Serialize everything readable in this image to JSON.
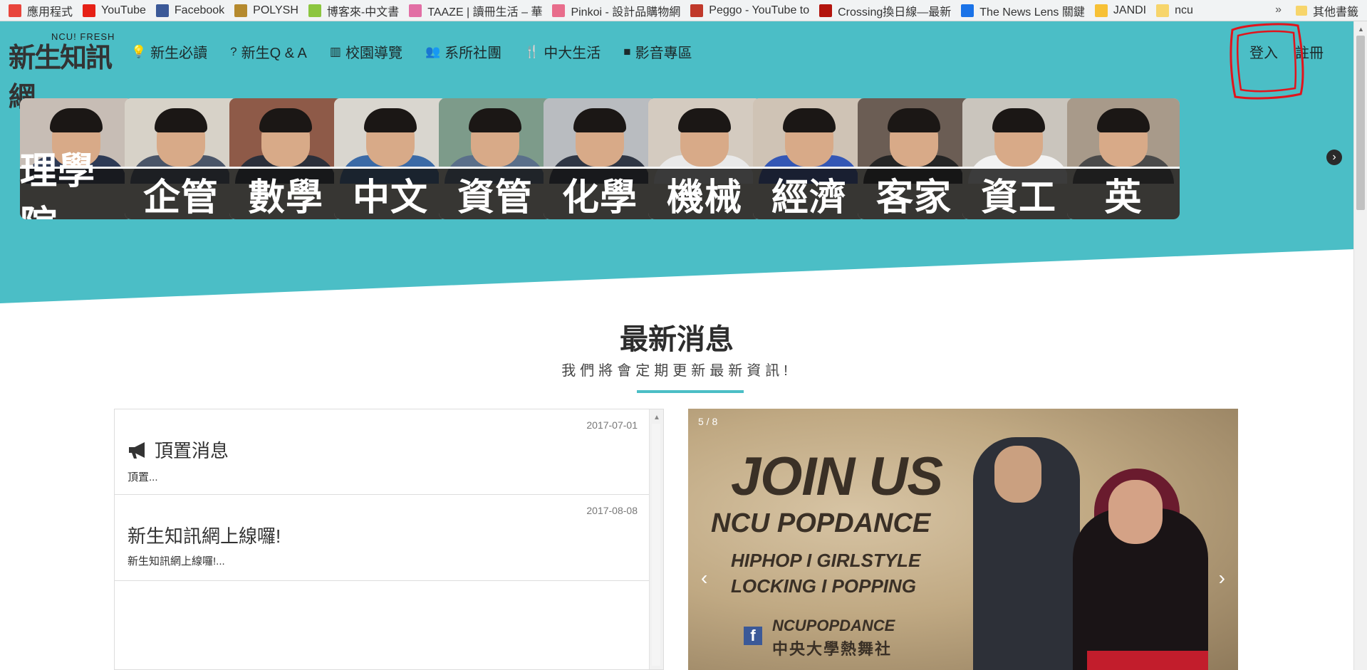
{
  "bookmarks": [
    {
      "label": "應用程式",
      "icon": "apps-grid-icon",
      "color": "#e8453c"
    },
    {
      "label": "YouTube",
      "icon": "youtube-icon",
      "color": "#e62117"
    },
    {
      "label": "Facebook",
      "icon": "facebook-icon",
      "color": "#3b5998"
    },
    {
      "label": "POLYSH",
      "icon": "polysh-icon",
      "color": "#b58a2e"
    },
    {
      "label": "博客來-中文書",
      "icon": "books-icon",
      "color": "#8cc63f"
    },
    {
      "label": "TAAZE | 讀冊生活 – 華",
      "icon": "taaze-icon",
      "color": "#e26fa5"
    },
    {
      "label": "Pinkoi - 設計品購物網",
      "icon": "pinkoi-icon",
      "color": "#e86d8c"
    },
    {
      "label": "Peggo - YouTube to",
      "icon": "music-note-icon",
      "color": "#c0392b"
    },
    {
      "label": "Crossing換日線—最新",
      "icon": "cw-icon",
      "color": "#b3140d"
    },
    {
      "label": "The News Lens 關鍵",
      "icon": "news-lens-icon",
      "color": "#1a73e8"
    },
    {
      "label": "JANDI",
      "icon": "jandi-icon",
      "color": "#f7c136"
    },
    {
      "label": "ncu",
      "icon": "folder-icon",
      "color": "#f7d56b"
    }
  ],
  "bookmarks_more": "»",
  "bookmarks_other": "其他書籤",
  "logo": {
    "main": "新生知訊網",
    "small": "NCU! FRESH"
  },
  "nav": [
    {
      "label": "新生必讀",
      "icon": "lightbulb-icon",
      "glyph": "💡"
    },
    {
      "label": "新生Q & A",
      "icon": "question-icon",
      "glyph": "?"
    },
    {
      "label": "校園導覽",
      "icon": "map-icon",
      "glyph": "▥"
    },
    {
      "label": "系所社團",
      "icon": "users-icon",
      "glyph": "👥"
    },
    {
      "label": "中大生活",
      "icon": "cutlery-icon",
      "glyph": "🍴"
    },
    {
      "label": "影音專區",
      "icon": "video-camera-icon",
      "glyph": "■"
    }
  ],
  "auth": {
    "login": "登入",
    "register": "註冊"
  },
  "departments": [
    {
      "label": "理學院",
      "shirt": "#2d3a55",
      "bg": "#c7bdb5"
    },
    {
      "label": "企管",
      "shirt": "#4a5568",
      "bg": "#d7d2c8"
    },
    {
      "label": "數學",
      "shirt": "#2b2f3a",
      "bg": "#8e5a48"
    },
    {
      "label": "中文",
      "shirt": "#3b6aa6",
      "bg": "#d9d6cf"
    },
    {
      "label": "資管",
      "shirt": "#5a6f8a",
      "bg": "#7d9b8a"
    },
    {
      "label": "化學",
      "shirt": "#2f3644",
      "bg": "#b9bcc0"
    },
    {
      "label": "機械",
      "shirt": "#e9e9e9",
      "bg": "#d4cbc0"
    },
    {
      "label": "經濟",
      "shirt": "#3457b5",
      "bg": "#cfc3b5"
    },
    {
      "label": "客家",
      "shirt": "#252525",
      "bg": "#6b5d54"
    },
    {
      "label": "資工",
      "shirt": "#f2f2f2",
      "bg": "#cac5bd"
    },
    {
      "label": "英",
      "shirt": "#4a4a4a",
      "bg": "#a89a8a"
    }
  ],
  "tiles_next": "›",
  "section": {
    "title": "最新消息",
    "subtitle": "我們將會定期更新最新資訊!"
  },
  "news": [
    {
      "date": "2017-07-01",
      "title": "頂置消息",
      "excerpt": "頂置...",
      "icon": "megaphone-icon"
    },
    {
      "date": "2017-08-08",
      "title": "新生知訊網上線囉!",
      "excerpt": "新生知訊網上線囉!..."
    }
  ],
  "carousel": {
    "counter": "5 / 8",
    "line1": "JOIN US",
    "line2": "NCU POPDANCE",
    "line3": "HIPHOP  I  GIRLSTYLE",
    "line4": "LOCKING  I  POPPING",
    "fb_handle": "NCUPOPDANCE",
    "club_name": "中央大學熱舞社",
    "prev": "‹",
    "next": "›"
  },
  "colors": {
    "accent": "#4bbec6",
    "annotation": "#e1141c"
  }
}
